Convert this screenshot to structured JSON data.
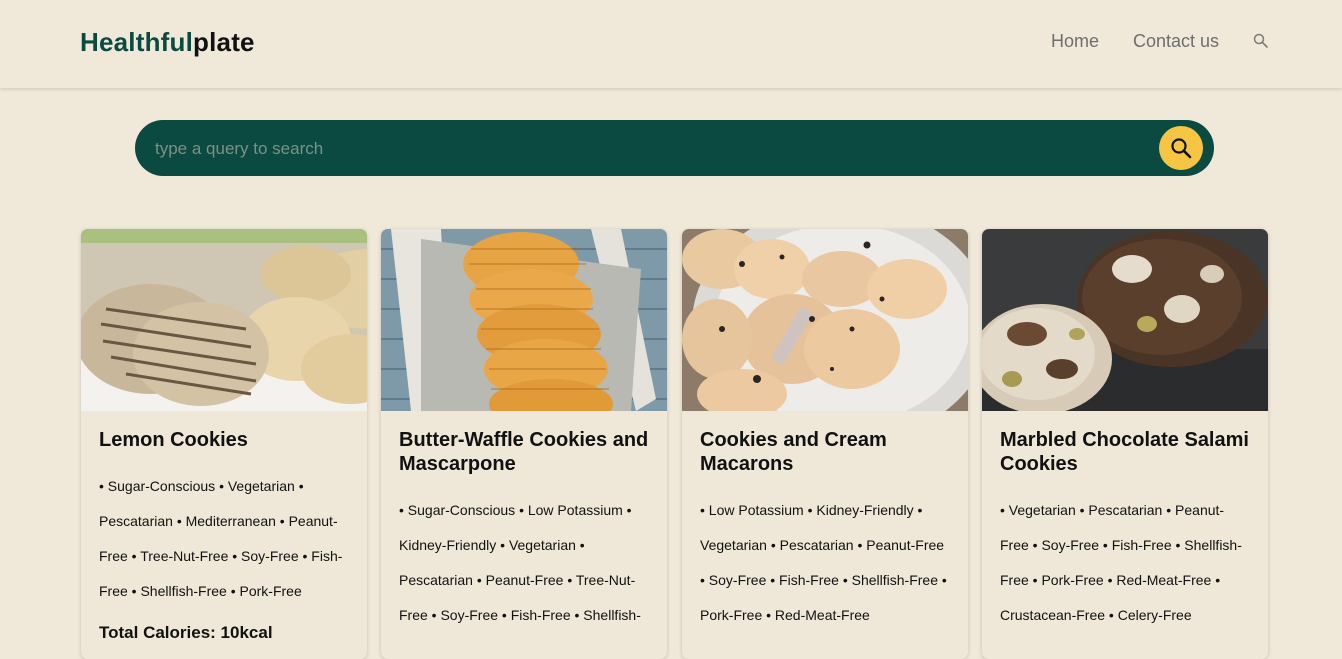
{
  "header": {
    "logo_part1": "Healthful",
    "logo_part2": "plate",
    "nav": {
      "home": "Home",
      "contact": "Contact us"
    }
  },
  "search": {
    "placeholder": "type a query to search",
    "value": ""
  },
  "cards": [
    {
      "title": "Lemon Cookies",
      "tags": "• Sugar-Conscious • Vegetarian • Pescatarian • Mediterranean • Peanut-Free • Tree-Nut-Free • Soy-Free • Fish-Free • Shellfish-Free • Pork-Free",
      "calories": "Total Calories: 10kcal"
    },
    {
      "title": "Butter-Waffle Cookies and Mascarpone",
      "tags": "• Sugar-Conscious • Low Potassium • Kidney-Friendly • Vegetarian • Pescatarian • Peanut-Free • Tree-Nut-Free • Soy-Free • Fish-Free • Shellfish-"
    },
    {
      "title": "Cookies and Cream Macarons",
      "tags": "• Low Potassium • Kidney-Friendly • Vegetarian • Pescatarian • Peanut-Free • Soy-Free • Fish-Free • Shellfish-Free • Pork-Free • Red-Meat-Free"
    },
    {
      "title": "Marbled Chocolate Salami Cookies",
      "tags": "• Vegetarian • Pescatarian • Peanut-Free • Soy-Free • Fish-Free • Shellfish-Free • Pork-Free • Red-Meat-Free • Crustacean-Free • Celery-Free"
    }
  ]
}
